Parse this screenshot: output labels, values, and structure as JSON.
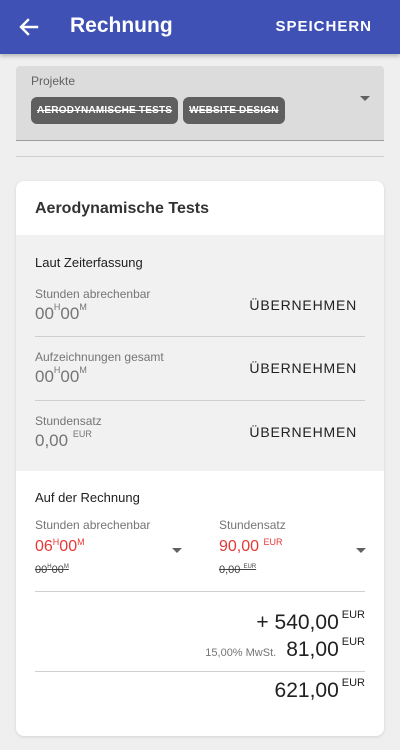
{
  "appbar": {
    "title": "Rechnung",
    "save_label": "SPEICHERN"
  },
  "projects": {
    "label": "Projekte",
    "chips": [
      "AERODYNAMISCHE TESTS",
      "WEBSITE DESIGN"
    ]
  },
  "card": {
    "title": "Aerodynamische Tests",
    "time_section": {
      "title": "Laut Zeiterfassung",
      "rows": [
        {
          "label": "Stunden abrechenbar",
          "h": "00",
          "h_unit": "H",
          "m": "00",
          "m_unit": "M",
          "button": "ÜBERNEHMEN"
        },
        {
          "label": "Aufzeichnungen gesamt",
          "h": "00",
          "h_unit": "H",
          "m": "00",
          "m_unit": "M",
          "button": "ÜBERNEHMEN"
        },
        {
          "label": "Stundensatz",
          "value": "0,00",
          "currency": "EUR",
          "button": "ÜBERNEHMEN"
        }
      ]
    },
    "invoice_section": {
      "title": "Auf der Rechnung",
      "hours": {
        "label": "Stunden abrechenbar",
        "h": "06",
        "h_unit": "H",
        "m": "00",
        "m_unit": "M",
        "old_h": "00",
        "old_m": "00"
      },
      "rate": {
        "label": "Stundensatz",
        "value": "90,00",
        "currency": "EUR",
        "old_value": "0,00",
        "old_currency": "EUR"
      }
    },
    "totals": {
      "net": "+ 540,00",
      "net_currency": "EUR",
      "vat_label": "15,00% MwSt.",
      "vat": "81,00",
      "vat_currency": "EUR",
      "total": "621,00",
      "total_currency": "EUR"
    }
  },
  "colors": {
    "primary": "#3f51b5",
    "accent_red": "#e53935"
  }
}
